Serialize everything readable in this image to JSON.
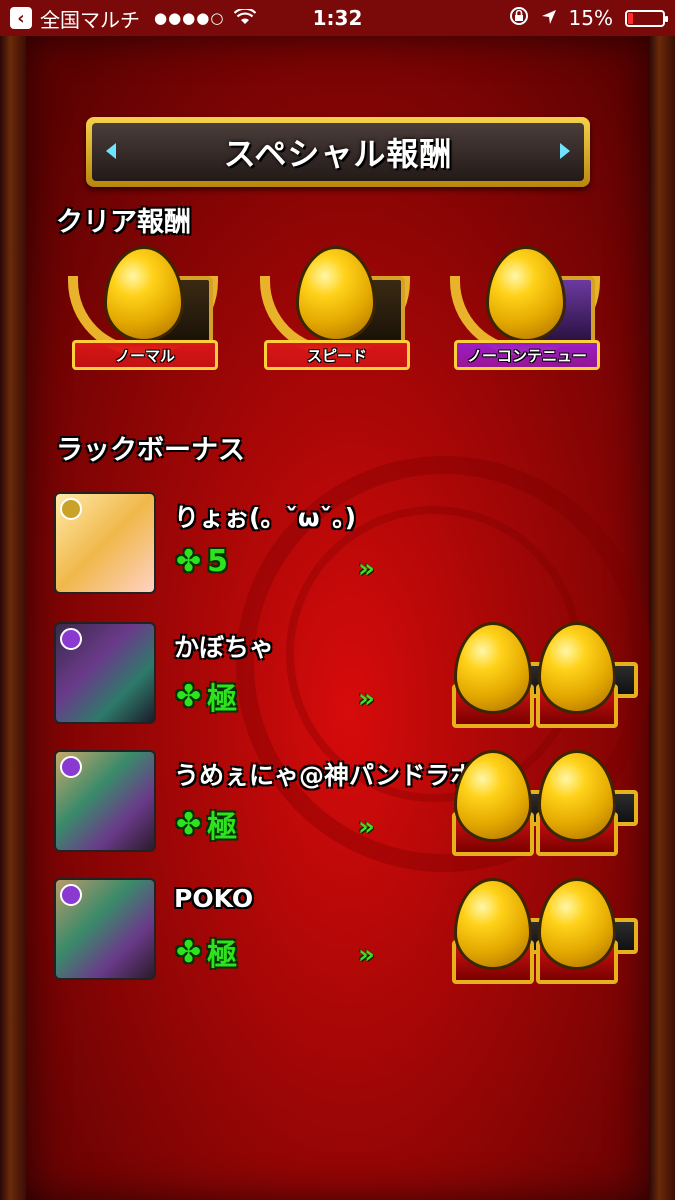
{
  "status_bar": {
    "carrier": "全国マルチ",
    "signal": "●●●●○",
    "time": "1:32",
    "battery": "15%",
    "battery_level": 0.15
  },
  "title": "スペシャル報酬",
  "clear_reward": {
    "heading": "クリア報酬",
    "medals": [
      {
        "label": "ノーマル",
        "ribbon_color": "#d81616"
      },
      {
        "label": "スピード",
        "ribbon_color": "#d81616"
      },
      {
        "label": "ノーコンテニュー",
        "ribbon_color": "#9a1cc7"
      }
    ]
  },
  "luck_bonus": {
    "heading": "ラックボーナス",
    "players": [
      {
        "name": "りょぉ(。ˇωˇ。)",
        "luck": "5",
        "bonus_eggs": 0
      },
      {
        "name": "かぼちゃ",
        "luck": "極",
        "bonus_eggs": 2
      },
      {
        "name": "うめぇにゃ@神パンドラボ",
        "luck": "極",
        "bonus_eggs": 2
      },
      {
        "name": "POKO",
        "luck": "極",
        "bonus_eggs": 2
      }
    ],
    "clover_icon": "✤",
    "arrow_icon": "»"
  }
}
